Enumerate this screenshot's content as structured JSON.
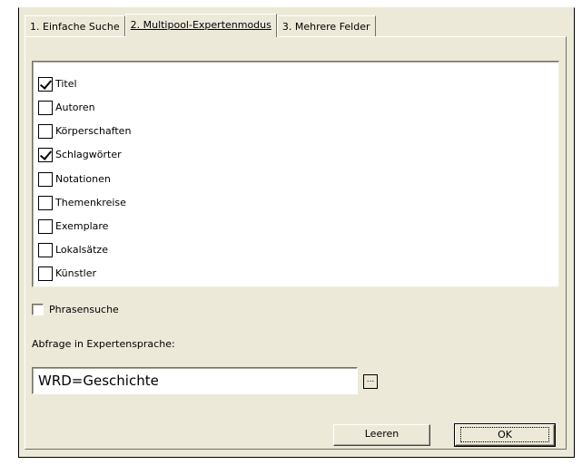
{
  "tabs": [
    {
      "label": "1. Einfache Suche",
      "active": false
    },
    {
      "label": "2. Multipool-Expertenmodus",
      "active": true
    },
    {
      "label": "3. Mehrere Felder",
      "active": false
    }
  ],
  "fields": [
    {
      "label": "Titel",
      "checked": true
    },
    {
      "label": "Autoren",
      "checked": false
    },
    {
      "label": "Körperschaften",
      "checked": false
    },
    {
      "label": "Schlagwörter",
      "checked": true
    },
    {
      "label": "Notationen",
      "checked": false
    },
    {
      "label": "Themenkreise",
      "checked": false
    },
    {
      "label": "Exemplare",
      "checked": false
    },
    {
      "label": "Lokalsätze",
      "checked": false
    },
    {
      "label": "Künstler",
      "checked": false
    }
  ],
  "phrase_search": {
    "label": "Phrasensuche",
    "checked": false
  },
  "query": {
    "label": "Abfrage in Expertensprache:",
    "value": "WRD=Geschichte",
    "browse_label": "..."
  },
  "buttons": {
    "clear_label": "Leeren",
    "ok_label": "OK"
  }
}
